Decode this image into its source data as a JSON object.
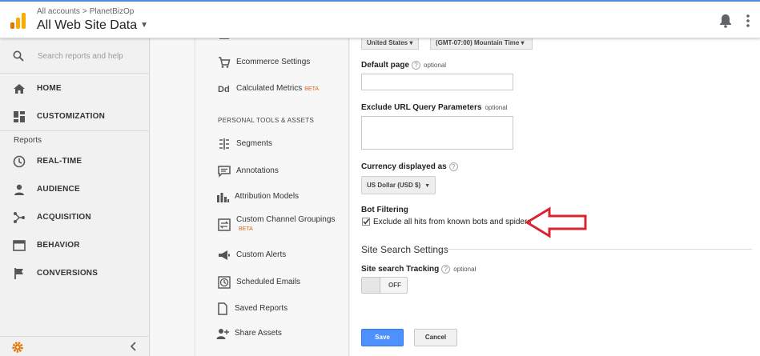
{
  "header": {
    "breadcrumb_root": "All accounts",
    "breadcrumb_sep": ">",
    "breadcrumb_account": "PlanetBizOp",
    "view_title": "All Web Site Data"
  },
  "nav": {
    "search_placeholder": "Search reports and help",
    "home": "HOME",
    "customization": "CUSTOMIZATION",
    "reports_heading": "Reports",
    "realtime": "REAL-TIME",
    "audience": "AUDIENCE",
    "acquisition": "ACQUISITION",
    "behavior": "BEHAVIOR",
    "conversions": "CONVERSIONS"
  },
  "admin_menu": {
    "ecommerce": "Ecommerce Settings",
    "calculated_metrics": "Calculated Metrics",
    "beta": "BETA",
    "section_personal": "PERSONAL TOOLS & ASSETS",
    "segments": "Segments",
    "annotations": "Annotations",
    "attribution": "Attribution Models",
    "custom_channel_1": "Custom Channel Groupings",
    "custom_alerts": "Custom Alerts",
    "scheduled_emails": "Scheduled Emails",
    "saved_reports": "Saved Reports",
    "share_assets": "Share Assets"
  },
  "settings": {
    "country_dropdown": "United States",
    "timezone_dropdown": "(GMT-07:00) Mountain Time",
    "default_page_label": "Default page",
    "optional": "optional",
    "default_page_value": "",
    "exclude_params_label": "Exclude URL Query Parameters",
    "exclude_params_value": "",
    "currency_label": "Currency displayed as",
    "currency_value": "US Dollar (USD $)",
    "bot_filtering_label": "Bot Filtering",
    "bot_filtering_checkbox_label": "Exclude all hits from known bots and spiders",
    "bot_filtering_checked": true,
    "site_search_section": "Site Search Settings",
    "site_search_tracking_label": "Site search Tracking",
    "site_search_toggle": "OFF",
    "save": "Save",
    "cancel": "Cancel",
    "help_mark": "?"
  },
  "colors": {
    "accent_blue": "#4d90fe",
    "annotation_arrow": "#d9232f",
    "beta_orange": "#e0651c",
    "logo_orange": "#f9ab00"
  }
}
